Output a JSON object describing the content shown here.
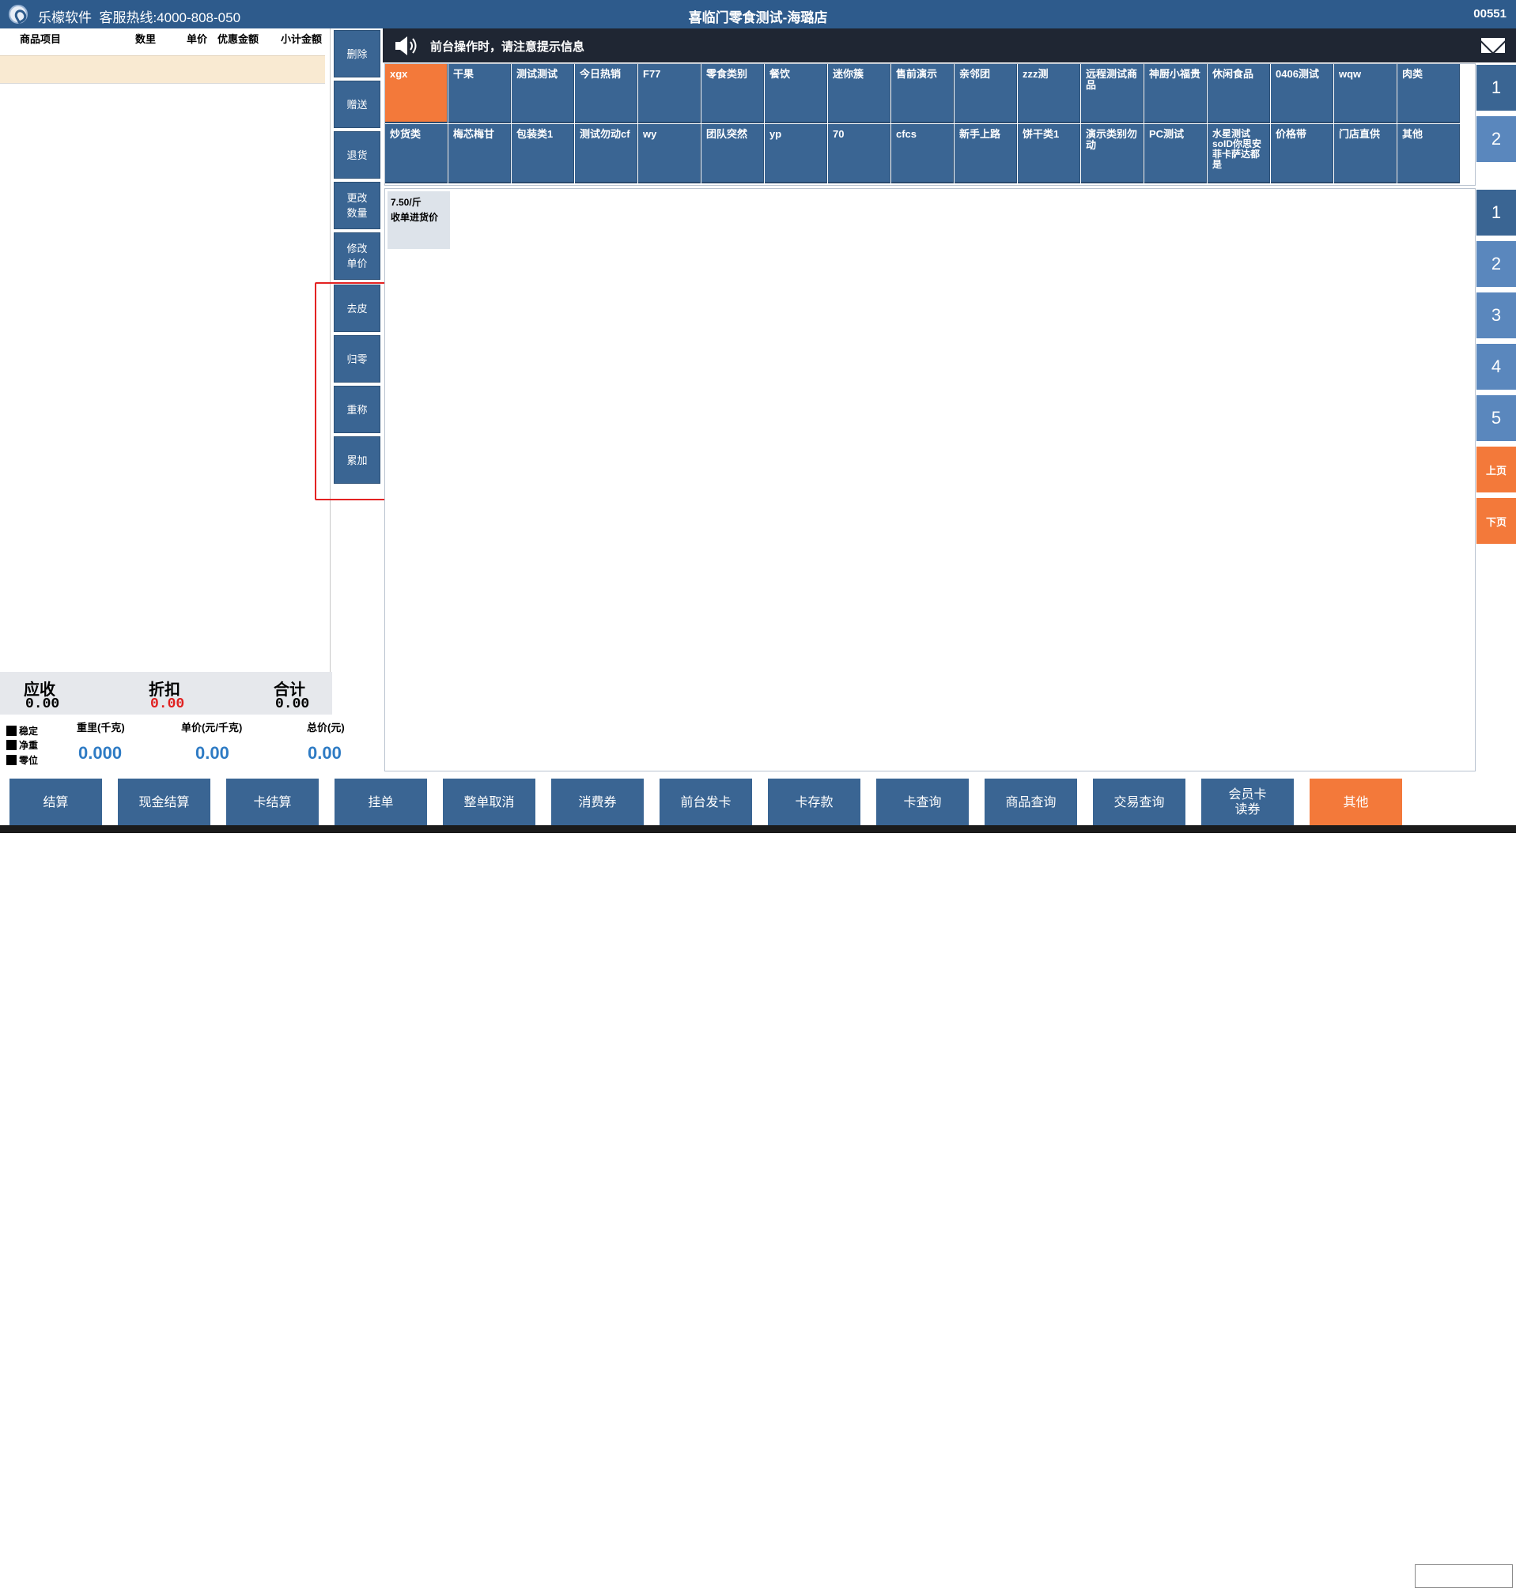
{
  "titlebar": {
    "brand": "乐檬软件  客服热线:4000-808-050",
    "store": "喜临门零食测试-海璐店",
    "code": "00551"
  },
  "order_table": {
    "headers": [
      "商品项目",
      "数里",
      "单价",
      "优惠金额",
      "小计金额"
    ]
  },
  "actions": [
    "删除",
    "赠送",
    "退货",
    "更改\n数量",
    "修改\n单价",
    "去皮",
    "归零",
    "重称",
    "累加"
  ],
  "totals": {
    "receivable_label": "应收",
    "receivable": "0.00",
    "discount_label": "折扣",
    "discount": "0.00",
    "total_label": "合计",
    "total": "0.00"
  },
  "scale": {
    "status": [
      "稳定",
      "净重",
      "零位"
    ],
    "weight_label": "重里(千克)",
    "weight": "0.000",
    "unit_price_label": "单价(元/千克)",
    "unit_price": "0.00",
    "total_price_label": "总价(元)",
    "total_price": "0.00"
  },
  "notice": {
    "text": "前台操作时，请注意提示信息"
  },
  "categories": {
    "row1": [
      "xgx",
      "干果",
      "测试测试",
      "今日热销",
      "F77",
      "零食类别",
      "餐饮",
      "迷你簇",
      "售前演示",
      "亲邻团",
      "zzz测",
      "远程测试商品",
      "神厨小福贵",
      "休闲食品",
      "0406测试",
      "wqw",
      "肉类"
    ],
    "row2": [
      "炒货类",
      "梅芯梅甘",
      "包装类1",
      "测试勿动cf",
      "wy",
      "团队突然",
      "yp",
      "70",
      "cfcs",
      "新手上路",
      "饼干类1",
      "演示类别勿动",
      "PC测试",
      "水星测试soID你思安菲卡萨达都是",
      "价格带",
      "门店直供",
      "其他"
    ],
    "active": "xgx"
  },
  "products": [
    {
      "price": "7.50/斤",
      "name": "收单进货价"
    }
  ],
  "category_pages": [
    "1",
    "2"
  ],
  "product_pages": [
    "1",
    "2",
    "3",
    "4",
    "5"
  ],
  "page_prev": "上页",
  "page_next": "下页",
  "bottom_buttons": [
    "结算",
    "现金结算",
    "卡结算",
    "挂单",
    "整单取消",
    "消费券",
    "前台发卡",
    "卡存款",
    "卡查询",
    "商品查询",
    "交易查询",
    "会员卡\n读券",
    "其他"
  ],
  "colors": {
    "primary": "#3a6593",
    "accent": "#f3793a",
    "titlebar": "#2e5b8c",
    "notice": "#1f2633",
    "highlight": "#e32222"
  }
}
